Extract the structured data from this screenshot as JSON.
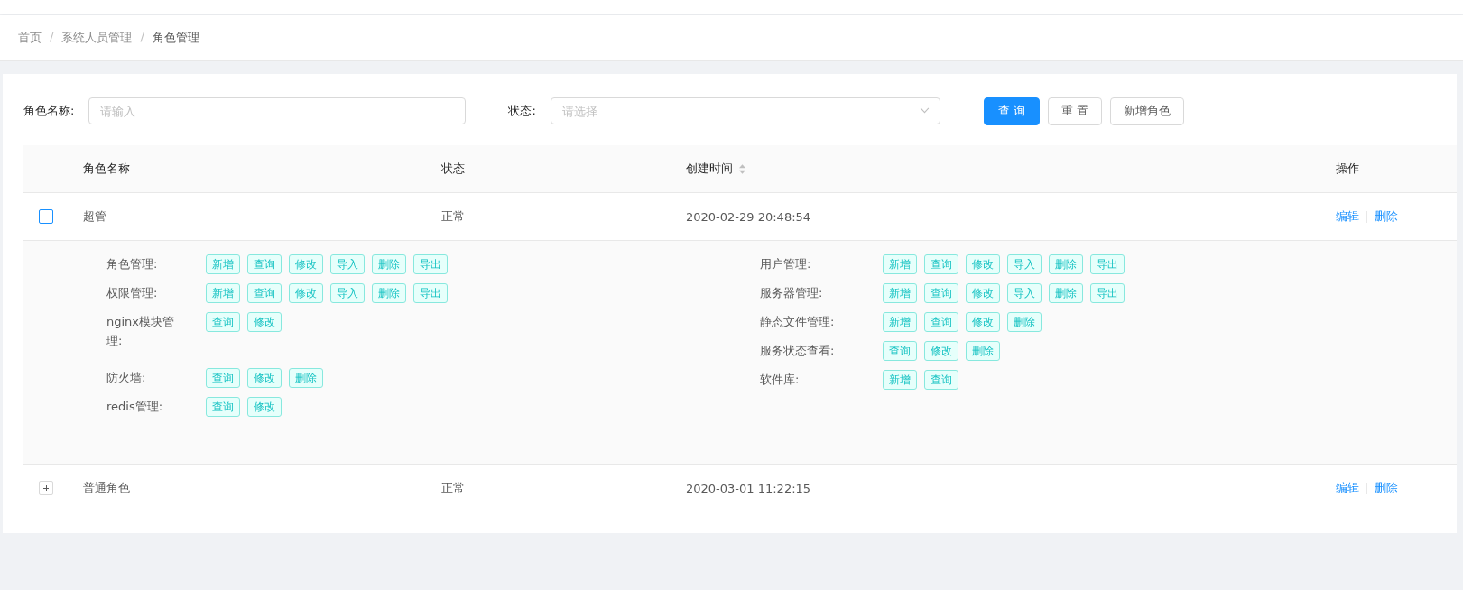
{
  "breadcrumb_separator": "/",
  "breadcrumb": [
    {
      "label": "首页",
      "current": false
    },
    {
      "label": "系统人员管理",
      "current": false
    },
    {
      "label": "角色管理",
      "current": true
    }
  ],
  "filters": [
    {
      "kind": "input",
      "label": "角色名称:",
      "placeholder": "请输入"
    },
    {
      "kind": "select",
      "label": "状态:",
      "placeholder": "请选择"
    }
  ],
  "buttons": [
    {
      "label": "查 询",
      "kind": "primary"
    },
    {
      "label": "重 置",
      "kind": "default"
    },
    {
      "label": "新增角色",
      "kind": "default"
    }
  ],
  "table": {
    "columns": [
      {
        "label": "角色名称",
        "sortable": false
      },
      {
        "label": "状态",
        "sortable": false
      },
      {
        "label": "创建时间",
        "sortable": true
      },
      {
        "label": "操作",
        "sortable": false
      }
    ],
    "rows": [
      {
        "expanded": true,
        "name": "超管",
        "status": "正常",
        "created": "2020-02-29 20:48:54",
        "actions": [
          "编辑",
          "删除"
        ],
        "permission_columns": [
          [
            {
              "module": "角色管理:",
              "ops": [
                "新增",
                "查询",
                "修改",
                "导入",
                "删除",
                "导出"
              ]
            },
            {
              "module": "权限管理:",
              "ops": [
                "新增",
                "查询",
                "修改",
                "导入",
                "删除",
                "导出"
              ]
            },
            {
              "module": "nginx模块管理:",
              "ops": [
                "查询",
                "修改"
              ]
            },
            {
              "module": "防火墙:",
              "ops": [
                "查询",
                "修改",
                "删除"
              ]
            },
            {
              "module": "redis管理:",
              "ops": [
                "查询",
                "修改"
              ]
            }
          ],
          [
            {
              "module": "用户管理:",
              "ops": [
                "新增",
                "查询",
                "修改",
                "导入",
                "删除",
                "导出"
              ]
            },
            {
              "module": "服务器管理:",
              "ops": [
                "新增",
                "查询",
                "修改",
                "导入",
                "删除",
                "导出"
              ]
            },
            {
              "module": "静态文件管理:",
              "ops": [
                "新增",
                "查询",
                "修改",
                "删除"
              ]
            },
            {
              "module": "服务状态查看:",
              "ops": [
                "查询",
                "修改",
                "删除"
              ]
            },
            {
              "module": "软件库:",
              "ops": [
                "新增",
                "查询"
              ]
            }
          ]
        ]
      },
      {
        "expanded": false,
        "name": "普通角色",
        "status": "正常",
        "created": "2020-03-01 11:22:15",
        "actions": [
          "编辑",
          "删除"
        ]
      }
    ]
  }
}
